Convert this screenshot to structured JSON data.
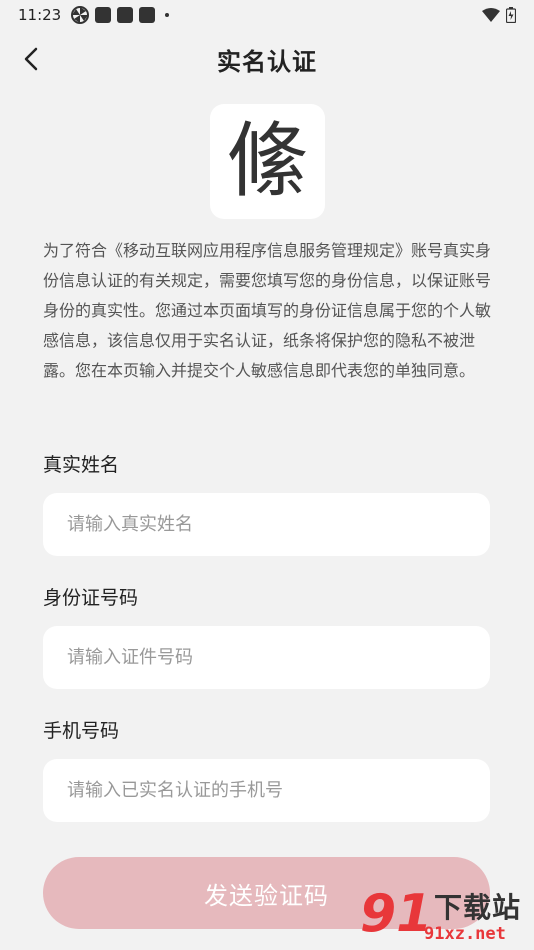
{
  "status_bar": {
    "time": "11:23"
  },
  "header": {
    "title": "实名认证"
  },
  "logo": {
    "glyph": "絛"
  },
  "notice": "为了符合《移动互联网应用程序信息服务管理规定》账号真实身份信息认证的有关规定，需要您填写您的身份信息，以保证账号身份的真实性。您通过本页面填写的身份证信息属于您的个人敏感信息，该信息仅用于实名认证，纸条将保护您的隐私不被泄露。您在本页输入并提交个人敏感信息即代表您的单独同意。",
  "form": {
    "name": {
      "label": "真实姓名",
      "value": "",
      "placeholder": "请输入真实姓名"
    },
    "id_number": {
      "label": "身份证号码",
      "value": "",
      "placeholder": "请输入证件号码"
    },
    "phone": {
      "label": "手机号码",
      "value": "",
      "placeholder": "请输入已实名认证的手机号"
    },
    "submit_label": "发送验证码"
  },
  "watermark": {
    "mark": "91",
    "title": "下载站",
    "url": "91xz.net"
  },
  "colors": {
    "background": "#f2f2f2",
    "button_disabled": "#e6b9bd",
    "watermark_red": "#e8373a"
  }
}
